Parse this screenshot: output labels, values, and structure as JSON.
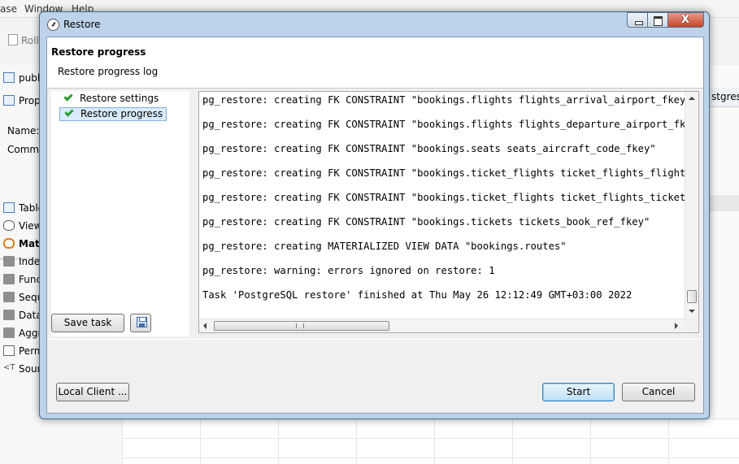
{
  "background": {
    "menu": [
      "ase",
      "Window",
      "Help"
    ],
    "rollback_label": "Roll",
    "editor_tab": "postgres",
    "left_rows": [
      {
        "label": "publ",
        "icon": "table-icon"
      },
      {
        "label": "Prop",
        "icon": "properties-icon"
      },
      {
        "label": "Name:",
        "icon": ""
      },
      {
        "label": "Comm",
        "icon": ""
      },
      {
        "label": "Table",
        "icon": "table-icon"
      },
      {
        "label": "View",
        "icon": "view-icon"
      },
      {
        "label": "Mate",
        "icon": "materialized-view-icon"
      },
      {
        "label": "Inde",
        "icon": "folder-icon"
      },
      {
        "label": "Func",
        "icon": "folder-icon"
      },
      {
        "label": "Sequ",
        "icon": "folder-icon"
      },
      {
        "label": "Data",
        "icon": "folder-icon"
      },
      {
        "label": "Aggr",
        "icon": "folder-icon"
      },
      {
        "label": "Perm",
        "icon": "key-icon"
      },
      {
        "label": "Sour",
        "icon": "source-icon"
      }
    ],
    "right_tab": "stgres"
  },
  "dialog": {
    "title": "Restore",
    "window_buttons": {
      "minimize": "minimize",
      "maximize": "maximize",
      "close": "X"
    },
    "header_title": "Restore progress",
    "header_subtitle": "Restore progress log",
    "nav": [
      {
        "label": "Restore settings",
        "selected": false,
        "icon": "check-icon"
      },
      {
        "label": "Restore progress",
        "selected": true,
        "icon": "check-icon"
      }
    ],
    "save_task_label": "Save task",
    "log_lines": [
      "pg_restore: creating FK CONSTRAINT \"bookings.flights flights_arrival_airport_fkey\"",
      "pg_restore: creating FK CONSTRAINT \"bookings.flights flights_departure_airport_fkey\"",
      "pg_restore: creating FK CONSTRAINT \"bookings.seats seats_aircraft_code_fkey\"",
      "pg_restore: creating FK CONSTRAINT \"bookings.ticket_flights ticket_flights_flight_id_fkey\"",
      "pg_restore: creating FK CONSTRAINT \"bookings.ticket_flights ticket_flights_ticket_no_fkey\"",
      "pg_restore: creating FK CONSTRAINT \"bookings.tickets tickets_book_ref_fkey\"",
      "pg_restore: creating MATERIALIZED VIEW DATA \"bookings.routes\"",
      "pg_restore: warning: errors ignored on restore: 1",
      "Task 'PostgreSQL restore' finished at Thu May 26 12:12:49 GMT+03:00 2022"
    ],
    "buttons": {
      "local_client": "Local Client ...",
      "start": "Start",
      "cancel": "Cancel"
    }
  }
}
